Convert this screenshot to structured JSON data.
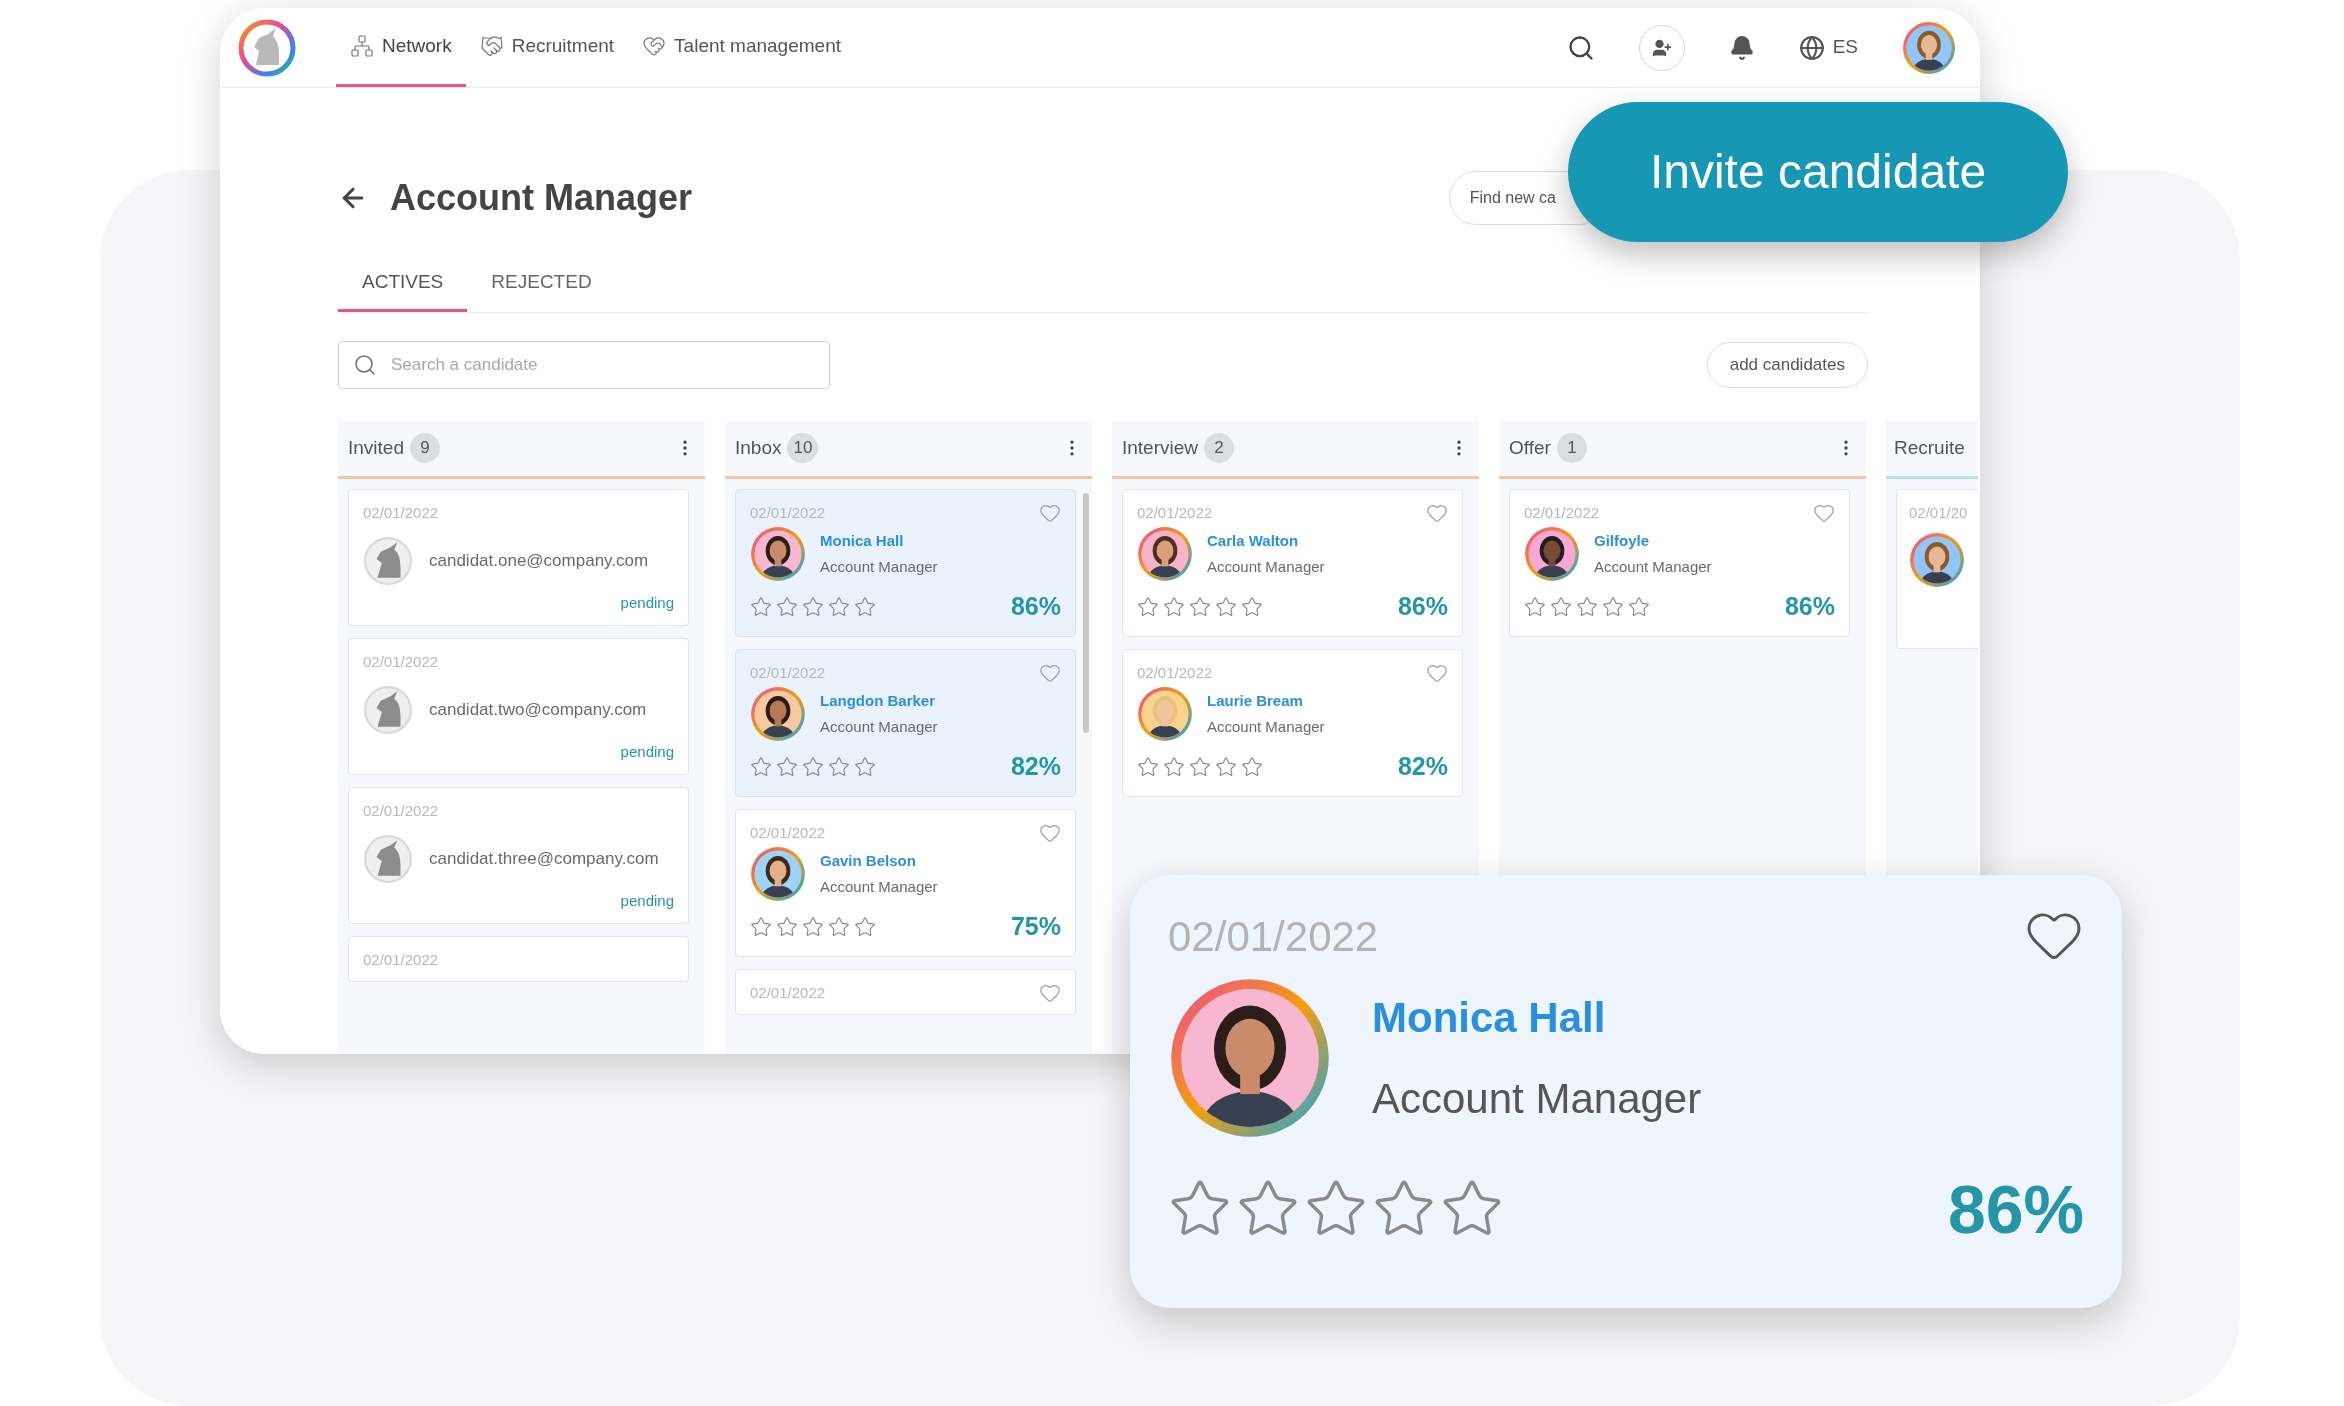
{
  "nav": {
    "items": [
      {
        "label": "Network",
        "kind": "network",
        "selected": true
      },
      {
        "label": "Recruitment",
        "kind": "handshake",
        "selected": false
      },
      {
        "label": "Talent management",
        "kind": "heart-hands",
        "selected": false
      }
    ],
    "language": "ES"
  },
  "page": {
    "title": "Account Manager",
    "find_button": "Find new ca",
    "tabs": [
      {
        "label": "ACTIVES",
        "selected": true
      },
      {
        "label": "REJECTED",
        "selected": false
      }
    ],
    "search": {
      "placeholder": "Search a candidate"
    },
    "add_button": "add candidates"
  },
  "columns": [
    {
      "title": "Invited",
      "count": "9",
      "cards": [
        {
          "kind": "invite",
          "date": "02/01/2022",
          "email": "candidat.one@company.com",
          "status": "pending"
        },
        {
          "kind": "invite",
          "date": "02/01/2022",
          "email": "candidat.two@company.com",
          "status": "pending"
        },
        {
          "kind": "invite",
          "date": "02/01/2022",
          "email": "candidat.three@company.com",
          "status": "pending"
        },
        {
          "kind": "invite",
          "date": "02/01/2022"
        }
      ]
    },
    {
      "title": "Inbox",
      "count": "10",
      "cards": [
        {
          "kind": "candidate",
          "selected": true,
          "date": "02/01/2022",
          "name": "Monica Hall",
          "role": "Account Manager",
          "stars": 0,
          "score": "86%"
        },
        {
          "kind": "candidate",
          "selected": true,
          "date": "02/01/2022",
          "name": "Langdon Barker",
          "role": "Account Manager",
          "stars": 0,
          "score": "82%"
        },
        {
          "kind": "candidate",
          "selected": false,
          "date": "02/01/2022",
          "name": "Gavin Belson",
          "role": "Account Manager",
          "stars": 0,
          "score": "75%"
        },
        {
          "kind": "candidate",
          "selected": false,
          "date": "02/01/2022"
        }
      ]
    },
    {
      "title": "Interview",
      "count": "2",
      "cards": [
        {
          "kind": "candidate",
          "selected": false,
          "date": "02/01/2022",
          "name": "Carla Walton",
          "role": "Account Manager",
          "stars": 0,
          "score": "86%"
        },
        {
          "kind": "candidate",
          "selected": false,
          "date": "02/01/2022",
          "name": "Laurie Bream",
          "role": "Account Manager",
          "stars": 0,
          "score": "82%"
        }
      ]
    },
    {
      "title": "Offer",
      "count": "1",
      "cards": [
        {
          "kind": "candidate",
          "selected": false,
          "date": "02/01/2022",
          "name": "Gilfoyle",
          "role": "Account Manager",
          "stars": 0,
          "score": "86%"
        }
      ]
    }
  ],
  "partial_column": {
    "title": "Recruite",
    "cards": [
      {
        "kind": "candidate",
        "selected": false,
        "date": "02/01/20"
      }
    ]
  },
  "invite_button": "Invite candidate",
  "featured_card": {
    "date": "02/01/2022",
    "name": "Monica Hall",
    "role": "Account Manager",
    "stars": 0,
    "score": "86%"
  }
}
